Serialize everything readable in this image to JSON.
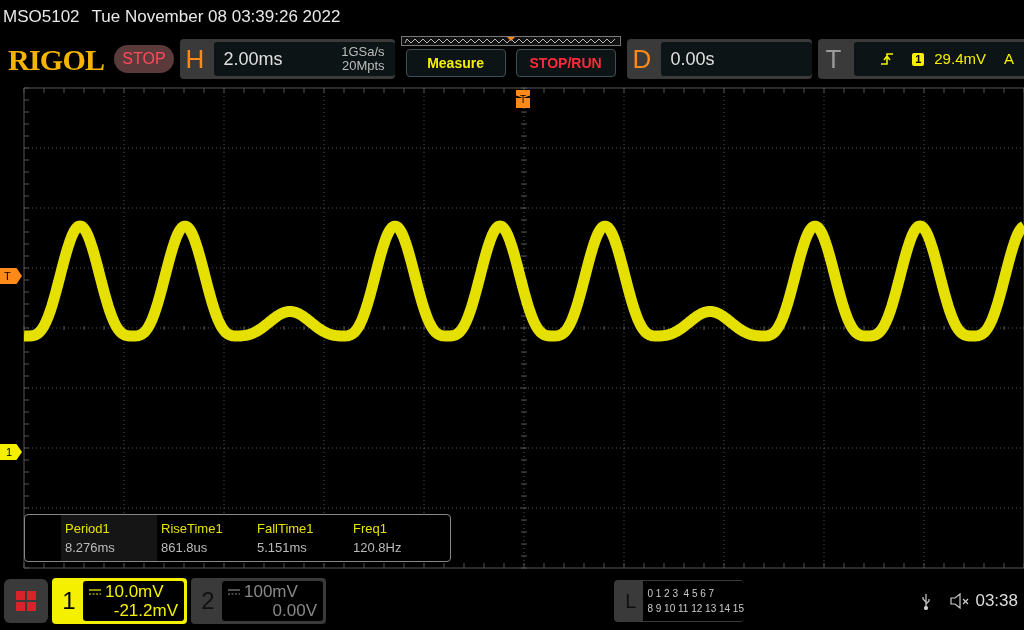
{
  "title_bar": {
    "model": "MSO5102",
    "datetime": "Tue November 08 03:39:26 2022"
  },
  "brand": "RIGOL",
  "run_state": {
    "label": "STOP"
  },
  "horizontal": {
    "letter": "H",
    "timebase": "2.00ms",
    "sample_rate": "1GSa/s",
    "memory_depth": "20Mpts"
  },
  "buttons": [
    {
      "label": "Measure",
      "kind": "measure"
    },
    {
      "label": "STOP/RUN",
      "kind": "stoprun"
    }
  ],
  "delay": {
    "letter": "D",
    "value": "0.00s"
  },
  "trigger": {
    "letter": "T",
    "source": "1",
    "level": "29.4mV",
    "mode": "A"
  },
  "markers": {
    "trigger_level": "T",
    "channel": "1",
    "trigger_position": "T"
  },
  "measurements": [
    {
      "label": "Period1",
      "value": "8.276ms",
      "selected": true
    },
    {
      "label": "RiseTime1",
      "value": "861.8us",
      "selected": false
    },
    {
      "label": "FallTime1",
      "value": "5.151ms",
      "selected": false
    },
    {
      "label": "Freq1",
      "value": "120.8Hz",
      "selected": false
    }
  ],
  "channels": [
    {
      "number": "1",
      "scale": "10.0mV",
      "offset": "-21.2mV",
      "selected": true
    },
    {
      "number": "2",
      "scale": "100mV",
      "offset": "0.00V",
      "selected": false
    }
  ],
  "logic": {
    "letter": "L",
    "row_1": "0 1 2 3  4 5 6 7",
    "row_2": "8 9 10 11 12 13 14 15"
  },
  "status": {
    "time": "03:38"
  }
}
